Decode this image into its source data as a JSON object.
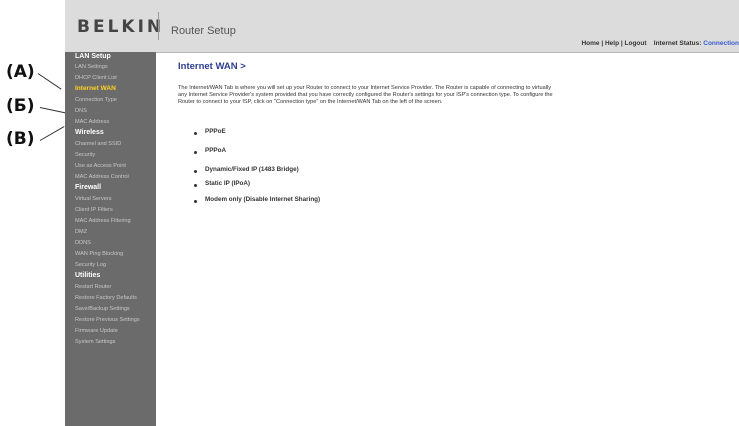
{
  "callouts": [
    "(A)",
    "(Б)",
    "(В)"
  ],
  "header": {
    "logo": "BELKIN",
    "title": "Router Setup",
    "links": {
      "home": "Home",
      "sep1": "|",
      "help": "Help",
      "sep2": "|",
      "logout": "Logout",
      "status_label": "Internet Status:",
      "status_value": "Connection"
    }
  },
  "sidebar": {
    "items": [
      {
        "label": "LAN Setup",
        "kind": "section"
      },
      {
        "label": "LAN Settings",
        "kind": "item"
      },
      {
        "label": "DHCP Client List",
        "kind": "item"
      },
      {
        "label": "Internet WAN",
        "kind": "active"
      },
      {
        "label": "Connection Type",
        "kind": "item"
      },
      {
        "label": "DNS",
        "kind": "item"
      },
      {
        "label": "MAC Address",
        "kind": "item"
      },
      {
        "label": "Wireless",
        "kind": "section"
      },
      {
        "label": "Channel and SSID",
        "kind": "item"
      },
      {
        "label": "Security",
        "kind": "item"
      },
      {
        "label": "Use as Access Point",
        "kind": "item"
      },
      {
        "label": "MAC Address Control",
        "kind": "item"
      },
      {
        "label": "Firewall",
        "kind": "section"
      },
      {
        "label": "Virtual Servers",
        "kind": "item"
      },
      {
        "label": "Client IP Filters",
        "kind": "item"
      },
      {
        "label": "MAC Address Filtering",
        "kind": "item"
      },
      {
        "label": "DMZ",
        "kind": "item"
      },
      {
        "label": "DDNS",
        "kind": "item"
      },
      {
        "label": "WAN Ping Blocking",
        "kind": "item"
      },
      {
        "label": "Security Log",
        "kind": "item"
      },
      {
        "label": "Utilities",
        "kind": "section"
      },
      {
        "label": "Restart Router",
        "kind": "item"
      },
      {
        "label": "Restore Factory Defaults",
        "kind": "item"
      },
      {
        "label": "Save/Backup Settings",
        "kind": "item"
      },
      {
        "label": "Restore Previous Settings",
        "kind": "item"
      },
      {
        "label": "Firmware Update",
        "kind": "item"
      },
      {
        "label": "System Settings",
        "kind": "item"
      }
    ]
  },
  "main": {
    "title": "Internet WAN >",
    "intro": "The Internet/WAN Tab is where you will set up your Router to connect to your Internet Service Provider. The Router is capable of connecting to virtually any Internet Service Provider's system provided that you have correctly configured the Router's settings for your ISP's connection type. To configure the Router to connect to your ISP, click on \"Connection type\" on the Internet/WAN Tab on the left of the screen.",
    "options": [
      "PPPoE",
      "PPPoA",
      "Dynamic/Fixed IP (1483 Bridge)",
      "Static IP (IPoA)",
      "Modem only (Disable Internet Sharing)"
    ]
  },
  "colors": {
    "header_bg": "#dcdcdc",
    "sidebar_bg": "#6b6b6b",
    "active_item": "#ffd21f",
    "title_blue": "#2d3f8f",
    "status_blue": "#3a5bd1"
  }
}
